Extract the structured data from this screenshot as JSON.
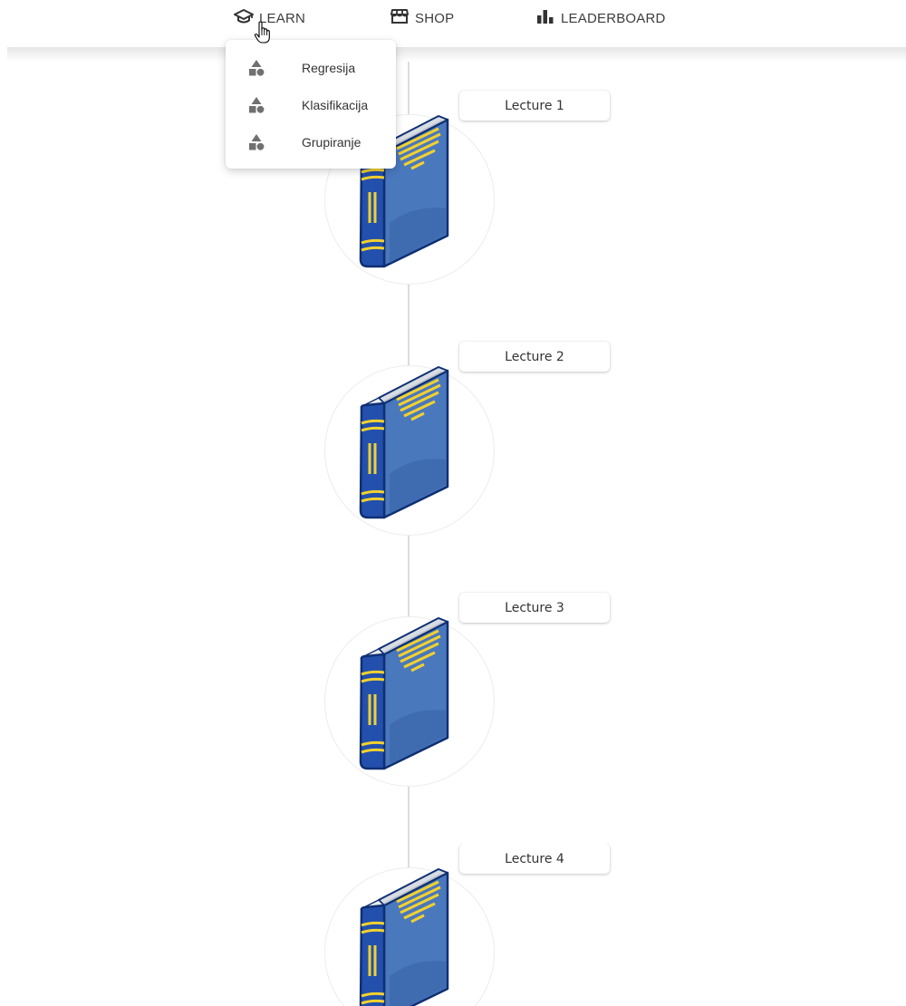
{
  "nav": {
    "learn": {
      "label": "LEARN",
      "icon": "graduation-cap-icon"
    },
    "shop": {
      "label": "SHOP",
      "icon": "store-icon"
    },
    "leaderboard": {
      "label": "LEADERBOARD",
      "icon": "bar-chart-icon"
    }
  },
  "dropdown": {
    "items": [
      {
        "label": "Regresija",
        "icon": "shapes-icon"
      },
      {
        "label": "Klasifikacija",
        "icon": "shapes-icon"
      },
      {
        "label": "Grupiranje",
        "icon": "shapes-icon"
      }
    ]
  },
  "lectures": [
    {
      "label": "Lecture 1",
      "icon": "book-icon"
    },
    {
      "label": "Lecture 2",
      "icon": "book-icon"
    },
    {
      "label": "Lecture 3",
      "icon": "book-icon"
    },
    {
      "label": "Lecture 4",
      "icon": "book-icon"
    }
  ],
  "colors": {
    "book_cover": "#2f5aa8",
    "book_spine": "#1f48a0",
    "book_outline": "#0f2f73",
    "book_stripes": "#f2d12e",
    "nav_text": "#3c3c3c",
    "timeline": "#dcdcdc"
  }
}
